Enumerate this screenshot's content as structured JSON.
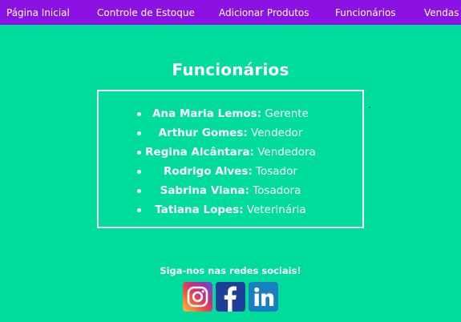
{
  "nav": {
    "items": [
      {
        "label": "Página Inicial"
      },
      {
        "label": "Controle de Estoque"
      },
      {
        "label": "Adicionar Produtos"
      },
      {
        "label": "Funcionários"
      },
      {
        "label": "Vendas"
      }
    ]
  },
  "main": {
    "title": "Funcionários",
    "staff": [
      {
        "name": "Ana Maria Lemos:",
        "role": " Gerente"
      },
      {
        "name": "Arthur Gomes:",
        "role": " Vendedor"
      },
      {
        "name": "Regina Alcântara:",
        "role": " Vendedora"
      },
      {
        "name": "Rodrigo Alves:",
        "role": " Tosador"
      },
      {
        "name": "Sabrina Viana:",
        "role": " Tosadora"
      },
      {
        "name": "Tatiana Lopes:",
        "role": " Veterinária"
      }
    ]
  },
  "footer": {
    "social_title": "Siga-nos nas redes sociais!",
    "icons": [
      "instagram-icon",
      "facebook-icon",
      "linkedin-icon"
    ]
  },
  "colors": {
    "background": "#00dc9b",
    "navbar": "#8c12e3",
    "text": "#ffffff"
  }
}
